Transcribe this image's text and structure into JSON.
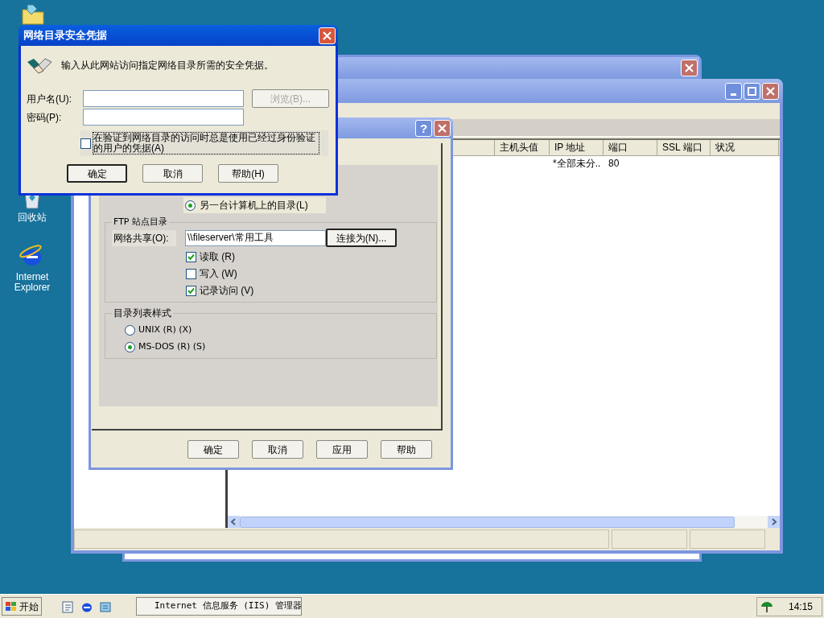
{
  "desktop_icons": [
    {
      "label": "回收站"
    },
    {
      "label": "Internet Explorer"
    }
  ],
  "iis_window": {
    "columns": [
      "主机头值",
      "IP 地址",
      "端口",
      "SSL 端口",
      "状况"
    ],
    "rows": [
      {
        "ip": "*全部未分..",
        "port": "80"
      }
    ]
  },
  "properties_dialog": {
    "help_button": "?",
    "location_option": {
      "label": "另一台计算机上的目录(L)",
      "selected": true
    },
    "ftp_group": {
      "title": "FTP 站点目录",
      "share_label": "网络共享(O):",
      "share_value": "\\\\fileserver\\常用工具",
      "connect_button": "连接为(N)...",
      "checkboxes": [
        {
          "label": "读取 (R)",
          "checked": true
        },
        {
          "label": "写入 (W)",
          "checked": false
        },
        {
          "label": "记录访问 (V)",
          "checked": true
        }
      ]
    },
    "listing_group": {
      "title": "目录列表样式",
      "options": [
        {
          "label": "UNIX (R) (X)",
          "selected": false
        },
        {
          "label": "MS-DOS (R) (S)",
          "selected": true
        }
      ]
    },
    "buttons": [
      "确定",
      "取消",
      "应用",
      "帮助"
    ]
  },
  "credentials_dialog": {
    "title": "网络目录安全凭据",
    "message": "输入从此网站访问指定网络目录所需的安全凭据。",
    "username_label": "用户名(U):",
    "password_label": "密码(P):",
    "browse_button": {
      "label": "浏览(B)...",
      "disabled": true
    },
    "remember": {
      "label": "在验证到网络目录的访问时总是使用已经过身份验证的用户的凭据(A)",
      "checked": false
    },
    "buttons": [
      "确定",
      "取消",
      "帮助(H)"
    ]
  },
  "taskbar": {
    "start": "开始",
    "task": "Internet 信息服务 (IIS) 管理器",
    "clock": "14:15"
  }
}
